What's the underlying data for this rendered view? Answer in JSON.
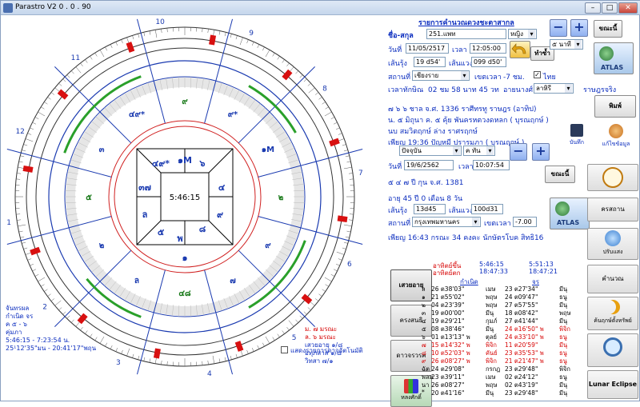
{
  "window": {
    "title": "Parastro V2  0 . 0 . 90",
    "minimize": "–",
    "maximize": "□",
    "close": "✕"
  },
  "chart": {
    "center_time": "5:46:15",
    "outer_numbers": [
      "1",
      "2",
      "3",
      "4",
      "5",
      "6",
      "7",
      "8",
      "9",
      "10",
      "11",
      "12"
    ],
    "houses": [
      "๓",
      "๔",
      "๕",
      "๖",
      "๗",
      "๘",
      "๙",
      "๑๐",
      "๑๑",
      "๑๒",
      "ล",
      "๒"
    ],
    "house_planets": [
      "๙",
      "๙*",
      "๑M",
      "๒",
      "๙",
      "๗",
      "๔๘",
      "ล",
      "๒",
      "๕",
      "๓",
      "๔๙*"
    ],
    "inner": {
      "top": "๑M",
      "ul": "๔๙*",
      "ur": "๖",
      "l": "๓๗",
      "r": "๔",
      "ml": "ล",
      "mr": "",
      "ll": "๕",
      "lr": "๘",
      "bl": "พ",
      "br": "๙",
      "b": "๑",
      "bb": "๖M"
    },
    "bottom_left": [
      "จันทรผล",
      "กำเนิด  จร",
      "ค  ๕ - ๖",
      "คุ่มภา",
      "5:46:15 - 7:23:54  น.",
      "25¹12'35\"มน - 20:41'17\"พฤน"
    ],
    "bottom_right": [
      "ม. ๗ มรณะ",
      "ล. ๖ มรณะ",
      "เสวยอายุ ๑/๘",
      "อทุภสาส ๑/๘",
      "วิทสา ๗/๑"
    ],
    "checkbox_label": "แสดงรายการดาวอัตโนมัติ"
  },
  "panel": {
    "header": "รายการคำนวณดวงชะตาสากล",
    "name_label": "ชื่อ-สกุล",
    "name_value": "251.แพท",
    "gender": "หญิง",
    "date_label": "วันที่",
    "date_value": "11/05/2517",
    "time_label": "เวลา",
    "time_value": "12:05:00",
    "lat_label": "เส้นรุ้ง",
    "lat_value": "19 d54'",
    "lon_label": "เส้นแวง",
    "lon_value": "099 d50'",
    "place_label": "สถานที่",
    "place_value": "เชียงราย",
    "tz_label": "เขตเวลา",
    "tz_value": "-7  ชม.",
    "thai_label": "ไทย",
    "sunrise_label": "เวลาทักษิณ",
    "sunrise_value": "02 ชม 58 นาท 45 วท",
    "ayanamsa_label": "อายนางศ์",
    "ayanamsa_value": "ลาหิรี",
    "rasi_label": "ราษฎรจริง",
    "info1": "๗ ๖  ๖     ชาล     จ.ศ. 1336 ราศีทรทู  ราษฎร (อาทิป)",
    "info2": "น. ๕ มิถุนา ค. ๕ คุ้ย  พันครหตวงดหลก ( บุรณฤกษ์ )",
    "info3": "นบ สมวิตฤกษ์    ล่าง ราศรฤกษ์",
    "info4": "เพียญ 19:36  ปัญหมี      ปรารมภา ( บุรณฤกษ์ )",
    "now_sel": "ปัจจุบัน",
    "now_sel2": "ค ทัน",
    "date2_value": "19/6/2562",
    "time2_value": "10:07:54",
    "info5": "๕ ๔ ๗  ปี กุน      จ.ศ. 1381",
    "info6": "อายุ  45 ปี  0  เดือน  8  วัน",
    "lat2_value": "13d45",
    "lon2_value": "100d31",
    "place2_value": "กรุงเทพมหานคร",
    "tz2_value": "-7.00",
    "info7": "เพียญ 16:43  กรณะ 34 คงคะ     นักษัตรโบค สิทธิ16",
    "tab1": "เสวยอายุ",
    "tab2": "ครงสนธิ",
    "tab3": "ดาวจรวรค",
    "tab4": "หลงศักดิ์",
    "t_header1": "อาทิตย์ขึ้น",
    "t_header2": "อาทิตย์ตก",
    "t_rise": "5:46:15",
    "t_set": "18:47:33",
    "t_rise2": "5:51:13",
    "t_set2": "18:47:21",
    "col1": "กำเนิด",
    "col2": "จร",
    "rows": [
      [
        "ล",
        "26 ต38'03\"",
        "เมษ",
        "23 ต27'34\"",
        "มีนุ",
        0
      ],
      [
        "๑",
        "21 ต55'02\"",
        "พฤษ",
        "24 ต09'47\"",
        "ธนู",
        0
      ],
      [
        "๒",
        "04 ต23'39\"",
        "พฤษ",
        "27 ต57'55\"",
        "มีนุ",
        0
      ],
      [
        "๓",
        "19 ต00'00\"",
        "มีนุ",
        "18 ต08'42\"",
        "พฤษ",
        0
      ],
      [
        "๔",
        "19 ต29'21\"",
        "กุมภ์",
        "27 ต41'44\"",
        "มีนุ",
        0
      ],
      [
        "๕",
        "08 ต38'46\"",
        "มีนุ",
        "24 ต16'50\" พ",
        "พิจิก",
        1
      ],
      [
        "๖",
        "01 ต13'13\" พ",
        "ตุลย์",
        "24 ต33'10\" พ",
        "ธนู",
        1
      ],
      [
        "๗",
        "15 ต14'32\" พ",
        "พิจิก",
        "11 ต20'59\"",
        "มีนุ",
        2
      ],
      [
        "๘",
        "10 ต52'03\" พ",
        "คันย์",
        "23 ต35'53\" พ",
        "ธนู",
        2
      ],
      [
        "๙",
        "26 ต08'27\" พ",
        "พิจิก",
        "21 ต21'47\" พ",
        "ธนู",
        2
      ],
      [
        "ฉัต",
        "24 ต29'08\"",
        "กรกฎ",
        "23 ต29'48\"",
        "พิจิก",
        0
      ],
      [
        "พลม",
        "23 ต39'11\"",
        "เมษ",
        "02 ต24'12\"",
        "ธนู",
        0
      ],
      [
        "นา",
        "26 ต08'27\"",
        "พฤษ",
        "02 ต43'19\"",
        "มีนุ",
        0
      ],
      [
        "*",
        "20 ต41'16\"",
        "มีนุ",
        "23 ต29'48\"",
        "มีนุ",
        0
      ]
    ],
    "btn_now": "ขณะนี้",
    "btn_5min": "๕ นาที",
    "btn_calc": "ทำซ้ำ",
    "btn_print": "พิมพ์",
    "btn_save": "บันทึก",
    "btn_share": "แก้ไขข้อมูล",
    "btn_now2": "ขณะนี้",
    "btn_atlas": "ATLAS",
    "btn_atlas2": "ATLAS",
    "side_clock": "",
    "side_transit": "ครสถาน",
    "side_progress": "ปรับแสง",
    "side_calc": "คำนวณ",
    "side_moon": "ค้นฤกษ์ตั้งทรัพย์",
    "side_search": "",
    "side_eclipse": "Lunar Eclipse"
  }
}
